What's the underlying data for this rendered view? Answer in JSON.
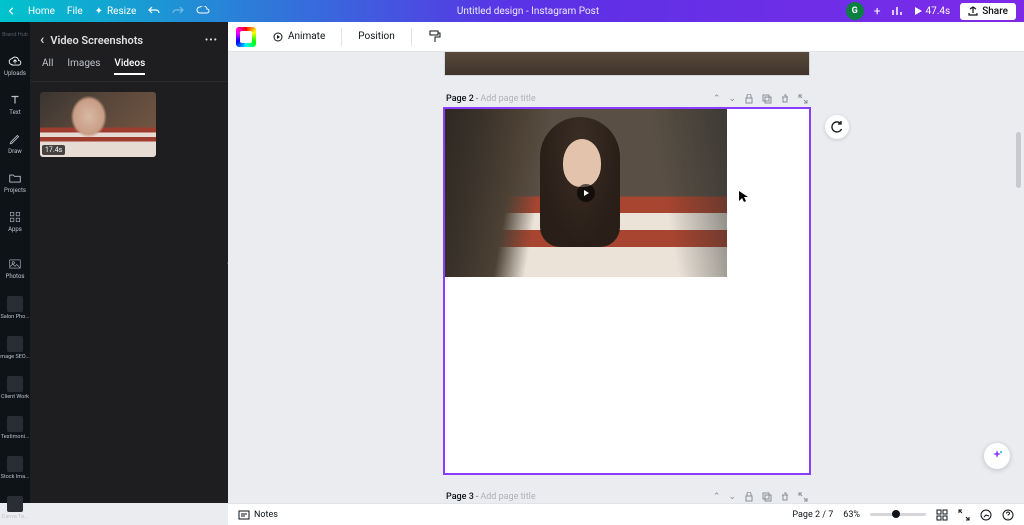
{
  "header": {
    "home": "Home",
    "file": "File",
    "resize": "Resize",
    "title": "Untitled design - Instagram Post",
    "avatar_letter": "G",
    "duration": "47.4s",
    "share": "Share"
  },
  "rail": {
    "item0": "Brand Hub",
    "uploads": "Uploads",
    "text": "Text",
    "draw": "Draw",
    "projects": "Projects",
    "apps": "Apps",
    "photos": "Photos",
    "folder1": "Salon Pho...",
    "folder2": "mage SEO...",
    "folder3": "Client Work",
    "folder4": "Testimoni...",
    "folder5": "Stock Ima...",
    "folder6": "Canva Te..."
  },
  "panel": {
    "title": "Video Screenshots",
    "tabs": {
      "all": "All",
      "images": "Images",
      "videos": "Videos"
    },
    "thumb_duration": "17.4s"
  },
  "toolbar": {
    "animate": "Animate",
    "position": "Position"
  },
  "canvas": {
    "page2_label": "Page 2",
    "page3_label": "Page 3",
    "separator": " - ",
    "add_title": "Add page title"
  },
  "bottom": {
    "notes": "Notes",
    "page_indicator": "Page 2 / 7",
    "zoom": "63%"
  },
  "icons": {
    "chevron_left": "‹",
    "chevron_down": "⌄",
    "chevron_up": "⌃",
    "ellipsis": "•••",
    "plus": "+",
    "lock": "lock",
    "duplicate": "dup",
    "trash": "del",
    "expand": "exp"
  }
}
